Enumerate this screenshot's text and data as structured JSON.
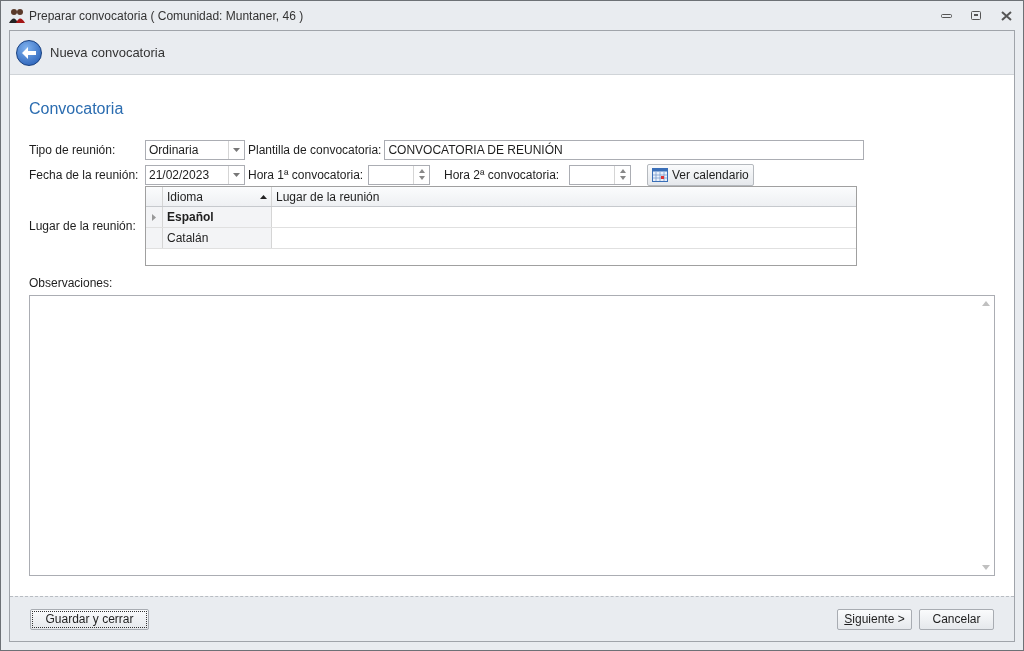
{
  "window": {
    "title": "Preparar convocatoria ( Comunidad: Muntaner, 46 )"
  },
  "header": {
    "title": "Nueva convocatoria"
  },
  "section": {
    "title": "Convocatoria"
  },
  "form": {
    "tipo_label": "Tipo de reunión:",
    "tipo_value": "Ordinaria",
    "plantilla_label": "Plantilla de convocatoria:",
    "plantilla_value": "CONVOCATORIA DE REUNIÓN",
    "fecha_label": "Fecha de la reunión:",
    "fecha_value": "21/02/2023",
    "hora1_label": "Hora 1ª convocatoria:",
    "hora2_label": "Hora 2ª convocatoria:",
    "calendar_button": "Ver calendario",
    "lugar_label": "Lugar de la reunión:",
    "observaciones_label": "Observaciones:"
  },
  "grid": {
    "columns": [
      {
        "label": "Idioma",
        "sorted": true
      },
      {
        "label": "Lugar de la reunión",
        "sorted": false
      }
    ],
    "rows": [
      {
        "idioma": "Español",
        "selected": true
      },
      {
        "idioma": "Catalán",
        "selected": false
      }
    ]
  },
  "footer": {
    "save_button": "Guardar y cerrar",
    "next_button": {
      "label": "Siguiente >"
    },
    "cancel_button": "Cancelar"
  }
}
